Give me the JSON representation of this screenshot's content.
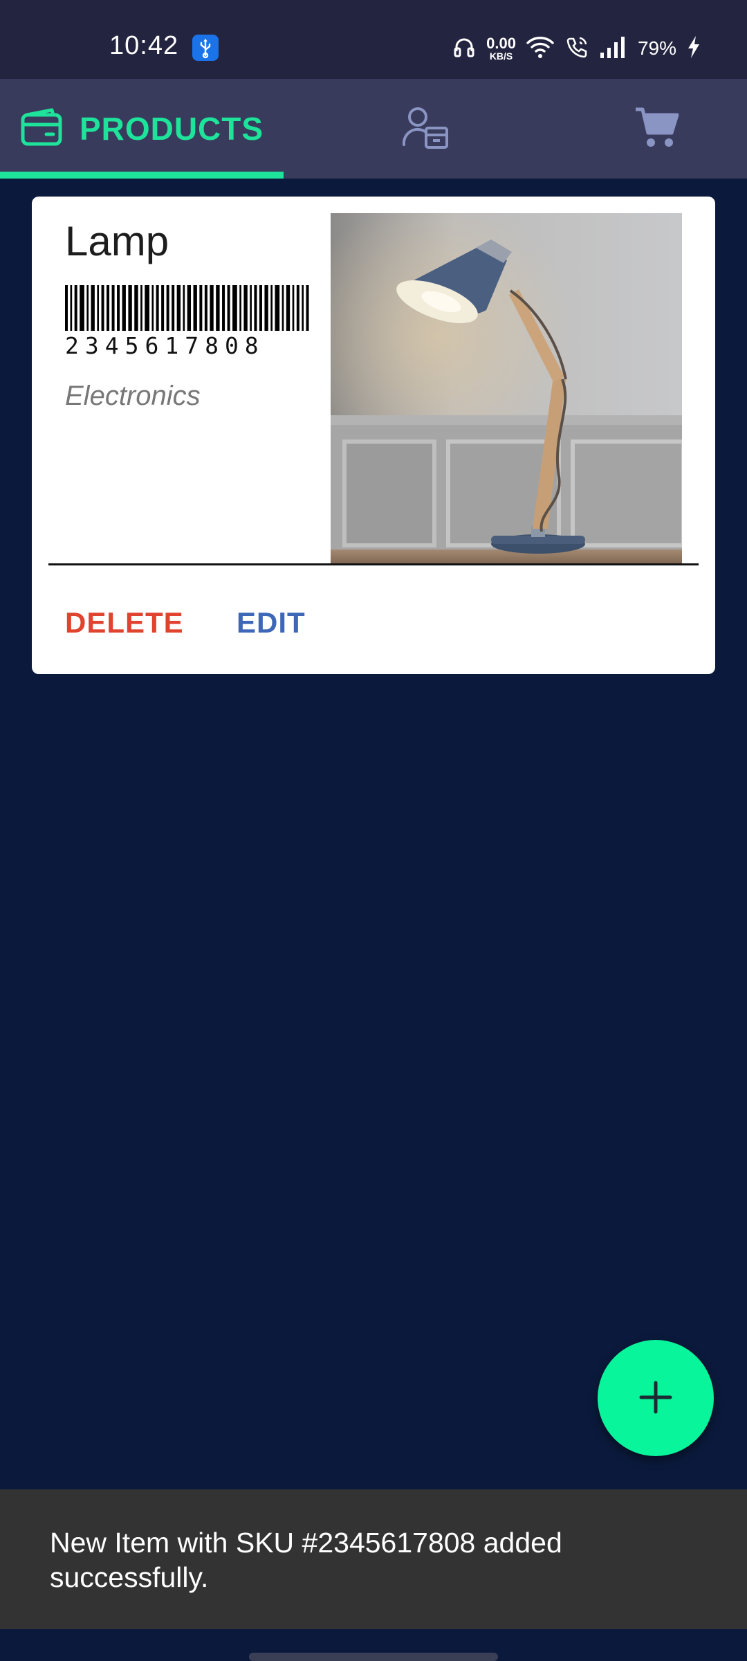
{
  "status_bar": {
    "time": "10:42",
    "net_speed_value": "0.00",
    "net_speed_unit": "KB/S",
    "battery_percent": "79%",
    "icons": [
      "usb-icon",
      "headphones-icon",
      "wifi-icon",
      "wifi-calling-icon",
      "signal-icon",
      "battery-charging-icon"
    ]
  },
  "tabs": [
    {
      "label": "PRODUCTS",
      "icon": "wallet-icon",
      "selected": true
    },
    {
      "label": "",
      "icon": "supplier-icon",
      "selected": false
    },
    {
      "label": "",
      "icon": "cart-icon",
      "selected": false
    }
  ],
  "product": {
    "name": "Lamp",
    "sku": "2345617808",
    "category": "Electronics",
    "image": "desk-lamp-photo"
  },
  "actions": {
    "delete_label": "DELETE",
    "edit_label": "EDIT"
  },
  "fab": {
    "icon": "plus-icon"
  },
  "snackbar": {
    "message": "New Item with SKU #2345617808 added successfully."
  },
  "colors": {
    "accent": "#1ee39a",
    "fab": "#09f59b",
    "background": "#0b1a3c",
    "app_bar": "#383b5c",
    "status_bar": "#23243f",
    "delete": "#e0432f",
    "edit": "#3e68b7",
    "snackbar": "#333333"
  }
}
